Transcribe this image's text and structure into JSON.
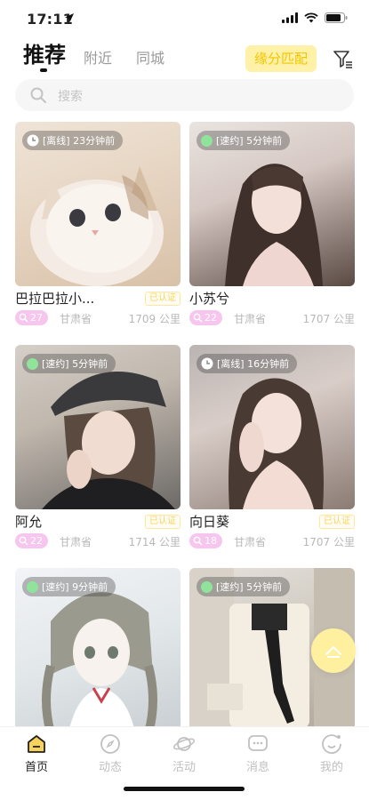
{
  "status_bar": {
    "time": "17:11"
  },
  "header": {
    "tabs": [
      {
        "label": "推荐",
        "active": true
      },
      {
        "label": "附近",
        "active": false
      },
      {
        "label": "同城",
        "active": false
      }
    ],
    "match_button": "缘分匹配",
    "accent_color": "#fff2a8"
  },
  "search": {
    "placeholder": "搜索"
  },
  "cards": [
    {
      "status": "[离线] 23分钟前",
      "status_type": "offline",
      "name": "巴拉巴拉小...",
      "verified": "已认证",
      "age": "27",
      "province": "甘肃省",
      "distance": "1709 公里"
    },
    {
      "status": "[速约] 5分钟前",
      "status_type": "online",
      "name": "小苏兮",
      "verified": "",
      "age": "22",
      "province": "甘肃省",
      "distance": "1707 公里"
    },
    {
      "status": "[速约] 5分钟前",
      "status_type": "online",
      "name": "阿允",
      "verified": "已认证",
      "age": "22",
      "province": "甘肃省",
      "distance": "1714 公里"
    },
    {
      "status": "[离线] 16分钟前",
      "status_type": "offline",
      "name": "向日葵",
      "verified": "已认证",
      "age": "18",
      "province": "甘肃省",
      "distance": "1707 公里"
    },
    {
      "status": "[速约] 9分钟前",
      "status_type": "online",
      "name": "",
      "verified": "",
      "age": "",
      "province": "",
      "distance": ""
    },
    {
      "status": "[速约] 5分钟前",
      "status_type": "online",
      "name": "",
      "verified": "",
      "age": "",
      "province": "",
      "distance": ""
    }
  ],
  "tabbar": [
    {
      "label": "首页",
      "icon": "home-icon",
      "active": true
    },
    {
      "label": "动态",
      "icon": "compass-icon",
      "active": false
    },
    {
      "label": "活动",
      "icon": "planet-icon",
      "active": false
    },
    {
      "label": "消息",
      "icon": "message-icon",
      "active": false
    },
    {
      "label": "我的",
      "icon": "profile-icon",
      "active": false
    }
  ]
}
